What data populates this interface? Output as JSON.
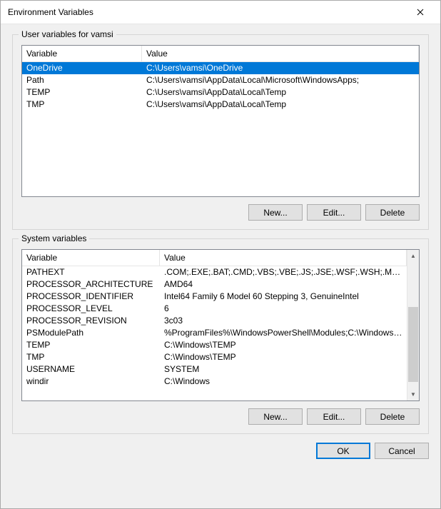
{
  "window": {
    "title": "Environment Variables"
  },
  "userSection": {
    "title": "User variables for vamsi",
    "headers": {
      "variable": "Variable",
      "value": "Value"
    },
    "rows": [
      {
        "variable": "OneDrive",
        "value": "C:\\Users\\vamsi\\OneDrive",
        "selected": true
      },
      {
        "variable": "Path",
        "value": "C:\\Users\\vamsi\\AppData\\Local\\Microsoft\\WindowsApps;",
        "selected": false
      },
      {
        "variable": "TEMP",
        "value": "C:\\Users\\vamsi\\AppData\\Local\\Temp",
        "selected": false
      },
      {
        "variable": "TMP",
        "value": "C:\\Users\\vamsi\\AppData\\Local\\Temp",
        "selected": false
      }
    ],
    "buttons": {
      "new": "New...",
      "edit": "Edit...",
      "delete": "Delete"
    }
  },
  "systemSection": {
    "title": "System variables",
    "headers": {
      "variable": "Variable",
      "value": "Value"
    },
    "rows": [
      {
        "variable": "PATHEXT",
        "value": ".COM;.EXE;.BAT;.CMD;.VBS;.VBE;.JS;.JSE;.WSF;.WSH;.MSC"
      },
      {
        "variable": "PROCESSOR_ARCHITECTURE",
        "value": "AMD64"
      },
      {
        "variable": "PROCESSOR_IDENTIFIER",
        "value": "Intel64 Family 6 Model 60 Stepping 3, GenuineIntel"
      },
      {
        "variable": "PROCESSOR_LEVEL",
        "value": "6"
      },
      {
        "variable": "PROCESSOR_REVISION",
        "value": "3c03"
      },
      {
        "variable": "PSModulePath",
        "value": "%ProgramFiles%\\WindowsPowerShell\\Modules;C:\\Windows\\syste..."
      },
      {
        "variable": "TEMP",
        "value": "C:\\Windows\\TEMP"
      },
      {
        "variable": "TMP",
        "value": "C:\\Windows\\TEMP"
      },
      {
        "variable": "USERNAME",
        "value": "SYSTEM"
      },
      {
        "variable": "windir",
        "value": "C:\\Windows"
      }
    ],
    "buttons": {
      "new": "New...",
      "edit": "Edit...",
      "delete": "Delete"
    }
  },
  "dialog": {
    "ok": "OK",
    "cancel": "Cancel"
  }
}
